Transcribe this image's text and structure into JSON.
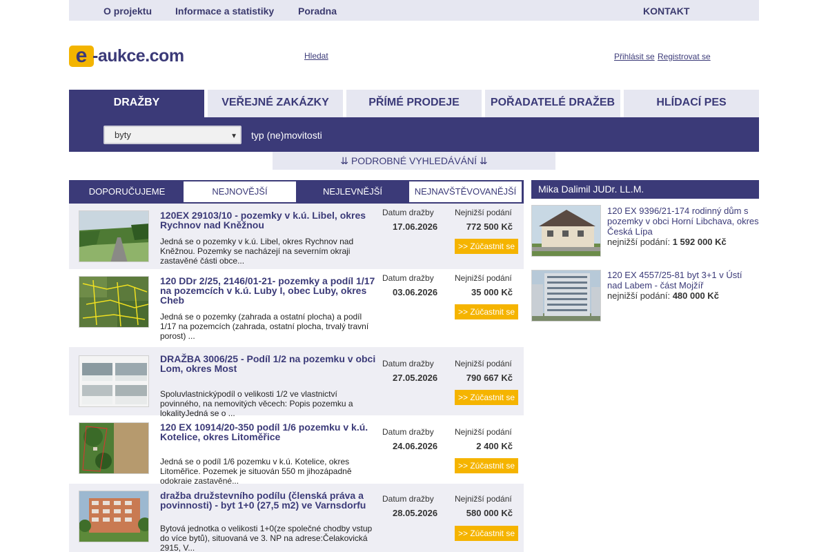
{
  "topnav": {
    "about": "O projektu",
    "info": "Informace a statistiky",
    "help": "Poradna",
    "contact": "KONTAKT"
  },
  "logo": {
    "letter": "e",
    "text": "-aukce.com"
  },
  "header": {
    "search_link": "Hledat",
    "login": "Přihlásit se",
    "register": "Registrovat se"
  },
  "mainnav": [
    "DRAŽBY",
    "VEŘEJNÉ ZAKÁZKY",
    "PŘÍMÉ PRODEJE",
    "POŘADATELÉ DRAŽEB",
    "HLÍDACÍ PES"
  ],
  "filter": {
    "select_value": "byty",
    "label": "typ (ne)movitosti"
  },
  "advanced_search": "⇊ PODROBNÉ VYHLEDÁVÁNÍ ⇊",
  "list_tabs": [
    "DOPORUČUJEME",
    "NEJNOVĚJŠÍ",
    "NEJLEVNĚJŠÍ",
    "NEJNAVŠTĚVOVANĚJŠÍ"
  ],
  "labels": {
    "date": "Datum dražby",
    "price": "Nejnižší podání",
    "participate": ">> Zúčastnit se"
  },
  "auctions": [
    {
      "title": "120EX 29103/10 - pozemky v k.ú. Libel, okres Rychnov nad Kněžnou",
      "desc": "Jedná se o pozemky v k.ú. Libel, okres Rychnov nad Kněžnou. Pozemky se nacházejí na severním okraji zastavěné části obce...",
      "date": "17.06.2026",
      "price": "772 500 Kč"
    },
    {
      "title": "120 DDr 2/25, 2146/01-21- pozemky a podíl 1/17 na pozemcích v k.ú. Luby I, obec Luby, okres Cheb",
      "desc": "Jedná se o pozemky (zahrada a ostatní plocha) a podíl 1/17 na pozemcích (zahrada, ostatní plocha, trvalý travní porost) ...",
      "date": "03.06.2026",
      "price": "35 000 Kč"
    },
    {
      "title": "DRAŽBA 3006/25 - Podíl 1/2 na pozemku v obci Lom, okres Most",
      "desc": "Spoluvlastnickýpodíl o velikosti 1/2 ve vlastnictví povinného, na nemovitých věcech: Popis pozemku a lokalityJedná se o ...",
      "date": "27.05.2026",
      "price": "790 667 Kč"
    },
    {
      "title": "120 EX 10914/20-350 podíl 1/6 pozemku v k.ú. Kotelice, okres Litoměřice",
      "desc": "Jedná se o podíl 1/6 pozemku v k.ú. Kotelice, okres Litoměřice. Pozemek je situován 550 m jihozápadně odokraje zastavěné...",
      "date": "24.06.2026",
      "price": "2 400 Kč"
    },
    {
      "title": "dražba družstevního podílu (členská práva a povinnosti) - byt 1+0 (27,5 m2) ve Varnsdorfu",
      "desc": "Bytová jednotka o velikosti 1+0(ze společné chodby vstup do více bytů), situovaná ve 3. NP na adrese:Čelakovická 2915, V...",
      "date": "28.05.2026",
      "price": "580 000 Kč"
    }
  ],
  "sidebar": {
    "heading": "Mika Dalimil JUDr. LL.M.",
    "price_label": "nejnižší podání:",
    "items": [
      {
        "title": "120 EX 9396/21-174 rodinný dům s pozemky v obci Horní Libchava, okres Česká Lípa",
        "price": "1 592 000 Kč"
      },
      {
        "title": "120 EX 4557/25-81 byt 3+1 v Ústí nad Labem - část Mojžíř",
        "price": "480 000 Kč"
      }
    ]
  },
  "colors": {
    "brand": "#3b3a78",
    "accent": "#f5b400",
    "light": "#e6e7f1"
  }
}
